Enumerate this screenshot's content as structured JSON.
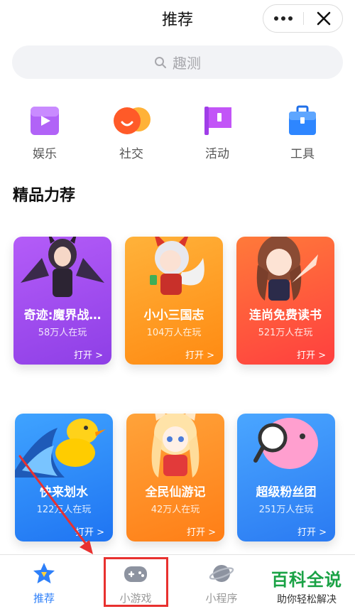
{
  "header": {
    "title": "推荐"
  },
  "search": {
    "placeholder": "趣测"
  },
  "categories": [
    {
      "label": "娱乐",
      "icon": "play-icon",
      "color": "#a451f5"
    },
    {
      "label": "社交",
      "icon": "chat-bubble-icon",
      "color": "#ff6a2a"
    },
    {
      "label": "活动",
      "icon": "flag-icon",
      "color": "#b43ff0"
    },
    {
      "label": "工具",
      "icon": "toolbox-icon",
      "color": "#2e86ff"
    }
  ],
  "section": {
    "title": "精品力荐"
  },
  "games": [
    {
      "name": "奇迹:魔界战…",
      "players": "58万人在玩",
      "open": "打开 >",
      "color": "#a34cf2"
    },
    {
      "name": "小小三国志",
      "players": "104万人在玩",
      "open": "打开 >",
      "color": "#ff9a1f"
    },
    {
      "name": "连尚免费读书",
      "players": "521万人在玩",
      "open": "打开 >",
      "color": "#ff5a3c"
    },
    {
      "name": "快来划水",
      "players": "122万人在玩",
      "open": "打开 >",
      "color": "#2f8cff"
    },
    {
      "name": "全民仙游记",
      "players": "42万人在玩",
      "open": "打开 >",
      "color": "#ff8a1e"
    },
    {
      "name": "超级粉丝团",
      "players": "251万人在玩",
      "open": "打开 >",
      "color": "#3b8ef8"
    }
  ],
  "tabs": [
    {
      "label": "推荐",
      "icon": "star-icon",
      "active": true
    },
    {
      "label": "小游戏",
      "icon": "gamepad-icon",
      "active": false
    },
    {
      "label": "小程序",
      "icon": "planet-icon",
      "active": false
    }
  ],
  "watermark": {
    "line1": "百科全说",
    "line2": "助你轻松解决"
  }
}
